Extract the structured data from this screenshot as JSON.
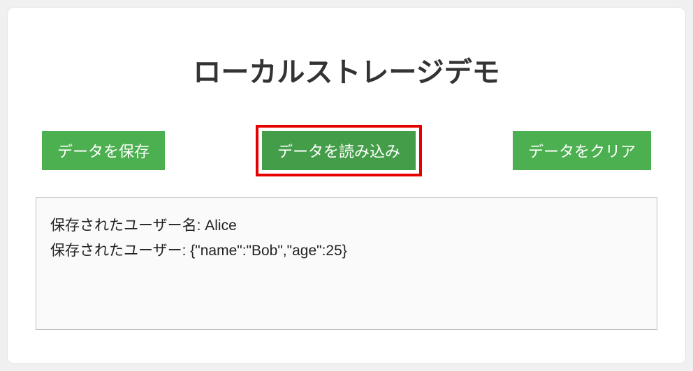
{
  "title": "ローカルストレージデモ",
  "buttons": {
    "save": "データを保存",
    "load": "データを読み込み",
    "clear": "データをクリア"
  },
  "output": {
    "line1": "保存されたユーザー名: Alice",
    "line2": "保存されたユーザー: {\"name\":\"Bob\",\"age\":25}"
  },
  "highlighted_button": "load",
  "colors": {
    "button_bg": "#4CAF50",
    "highlight_border": "#e60000"
  }
}
